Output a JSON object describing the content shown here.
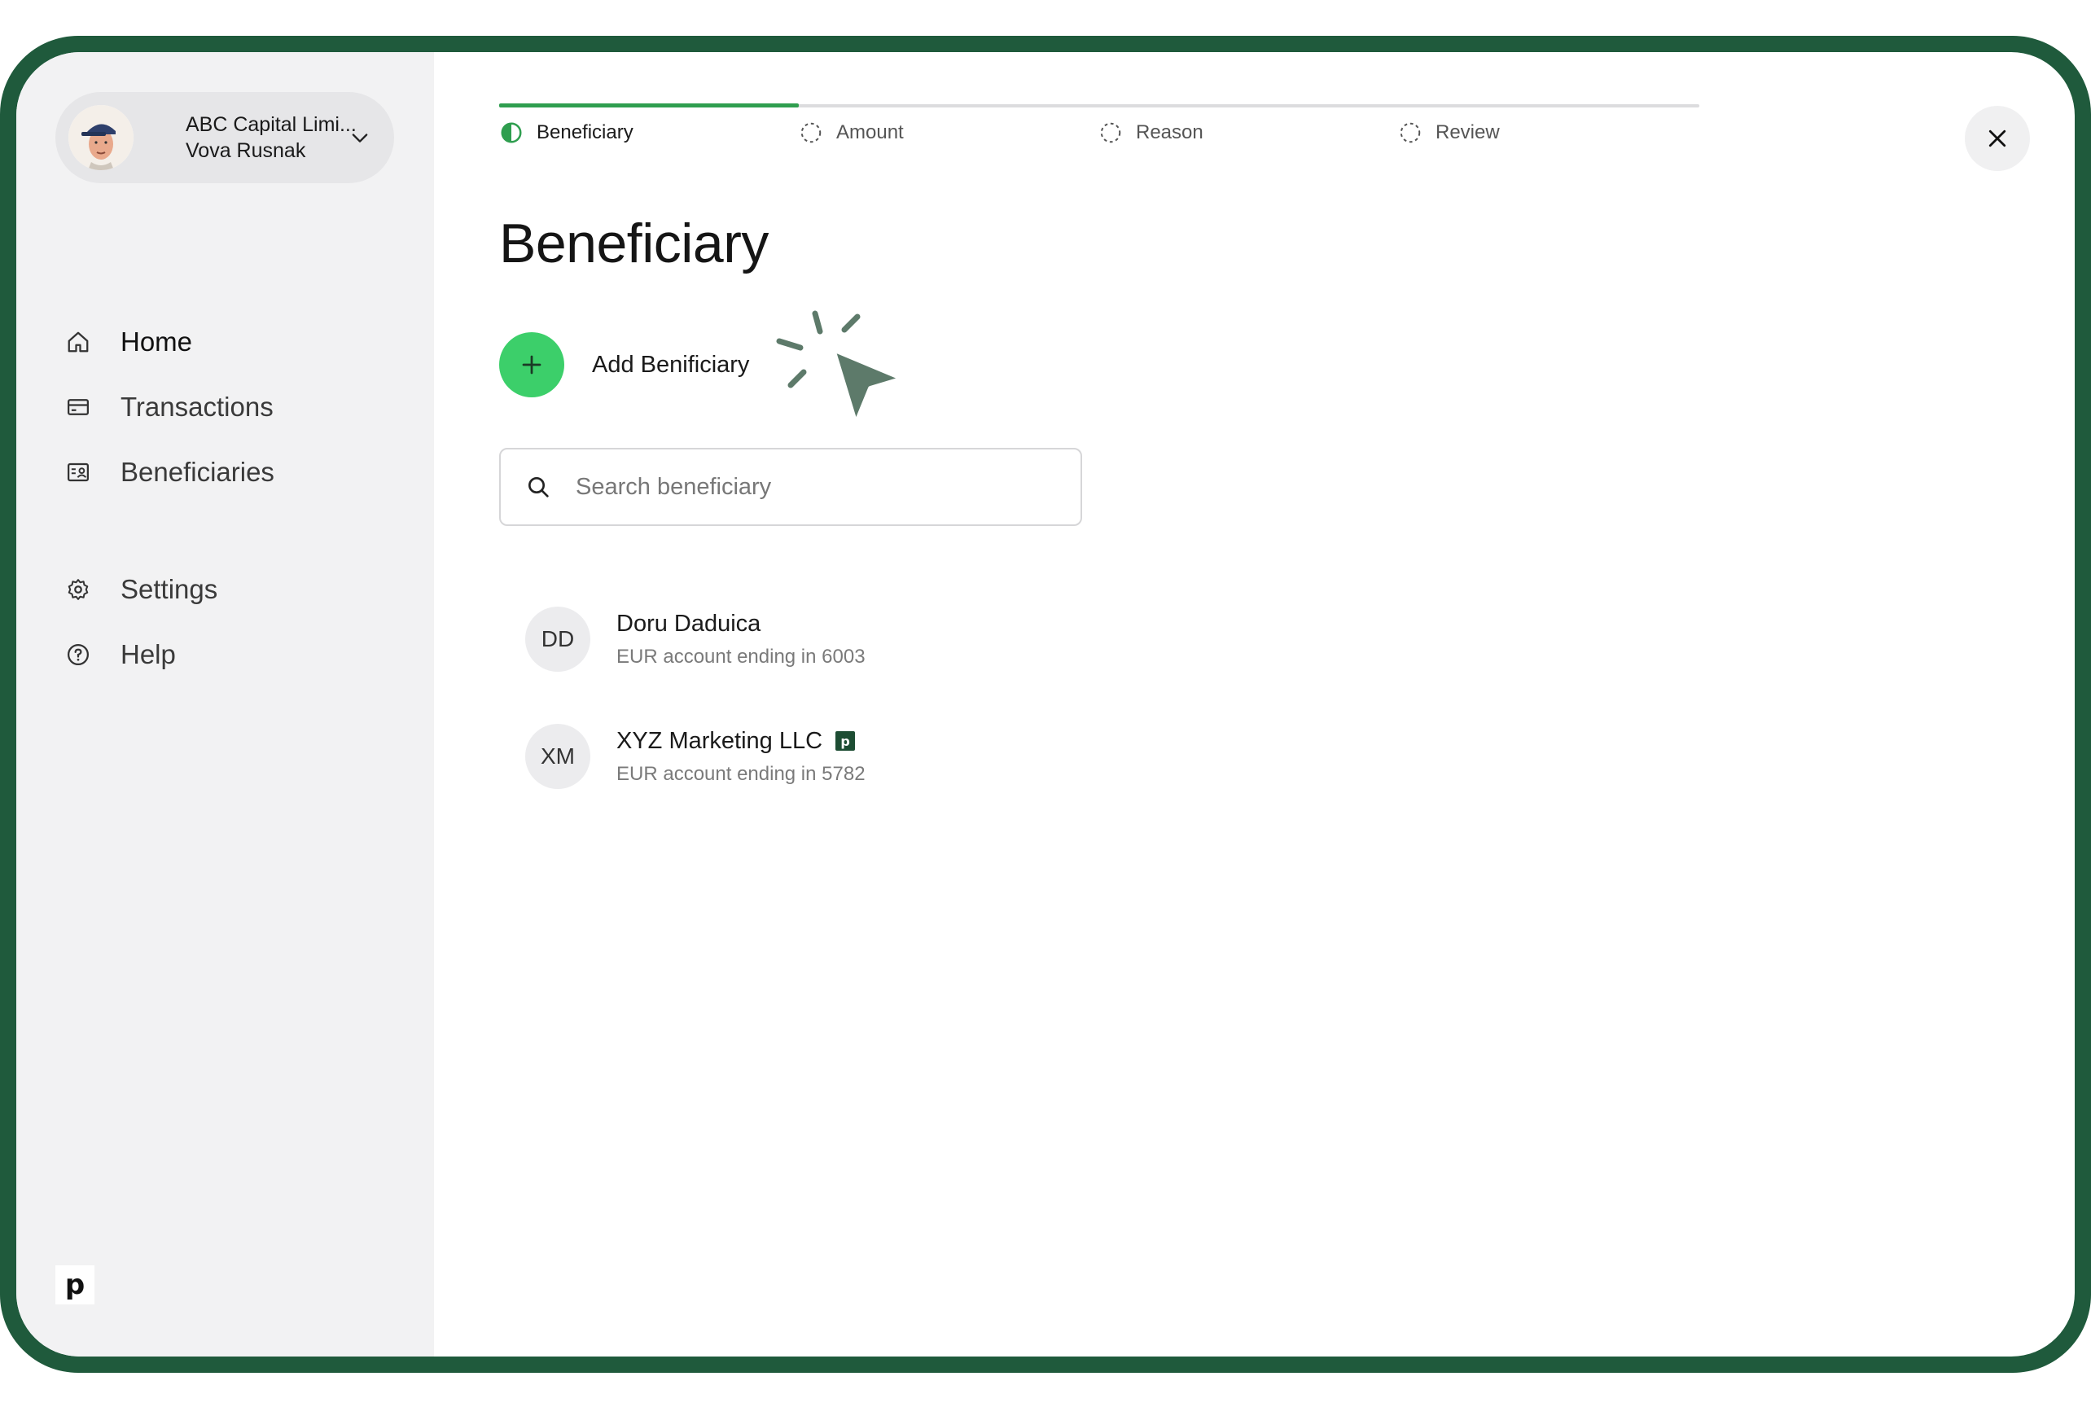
{
  "account": {
    "company": "ABC Capital Limi...",
    "user": "Vova Rusnak"
  },
  "sidebar": {
    "items": [
      {
        "label": "Home",
        "icon": "home-icon"
      },
      {
        "label": "Transactions",
        "icon": "card-icon"
      },
      {
        "label": "Beneficiaries",
        "icon": "contact-card-icon"
      },
      {
        "label": "Settings",
        "icon": "gear-icon"
      },
      {
        "label": "Help",
        "icon": "help-circle-icon"
      }
    ],
    "active": "Home",
    "brand_glyph": "p"
  },
  "steps": [
    {
      "label": "Beneficiary",
      "state": "active"
    },
    {
      "label": "Amount",
      "state": "pending"
    },
    {
      "label": "Reason",
      "state": "pending"
    },
    {
      "label": "Review",
      "state": "pending"
    }
  ],
  "progress": 0.25,
  "page": {
    "title": "Beneficiary",
    "add_label": "Add Benificiary",
    "search_placeholder": "Search beneficiary"
  },
  "beneficiaries": [
    {
      "initials": "DD",
      "name": "Doru Daduica",
      "account": "EUR account ending in 6003",
      "badge": ""
    },
    {
      "initials": "XM",
      "name": "XYZ Marketing LLC",
      "account": "EUR account ending in 5782",
      "badge": "p"
    }
  ],
  "colors": {
    "frame": "#1f5a3c",
    "accent": "#3ccf6a",
    "progress": "#2f9e4f",
    "cursor": "#5d7a6a",
    "badge": "#1d4d33"
  }
}
